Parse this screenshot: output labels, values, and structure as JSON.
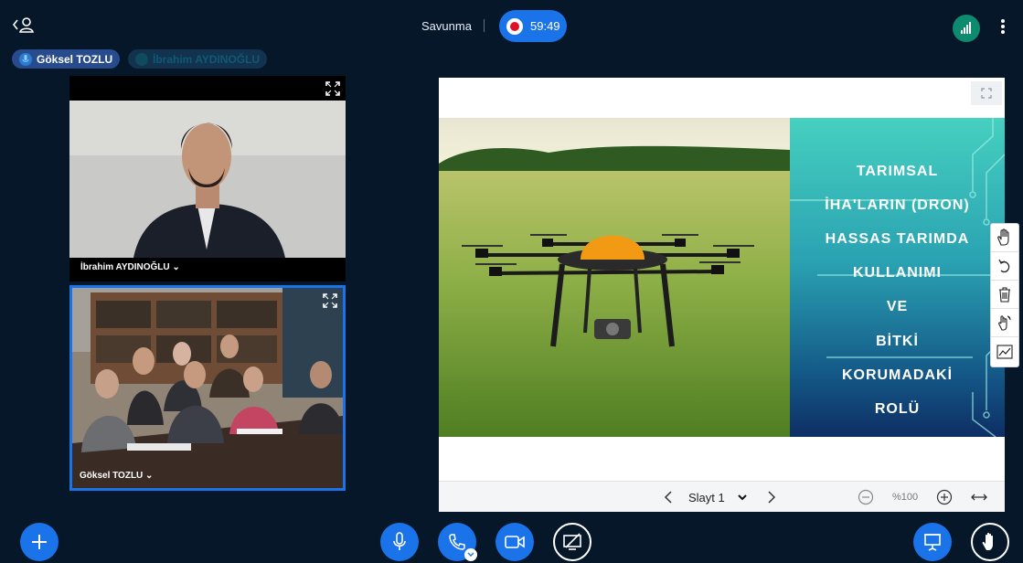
{
  "header": {
    "title": "Savunma",
    "timer": "59:49",
    "icons": [
      "user-icon",
      "record-icon",
      "connection-icon",
      "more-vertical-icon"
    ]
  },
  "participants": {
    "tags": [
      {
        "name": "Göksel TOZLU",
        "talking": true
      },
      {
        "name": "İbrahim AYDINOĞLU",
        "talking": false
      }
    ]
  },
  "videos": [
    {
      "label": "İbrahim AYDINOĞLU ⌄"
    },
    {
      "label": "Göksel TOZLU ⌄"
    }
  ],
  "slide": {
    "lines": [
      "TARIMSAL",
      "İHA'LARIN (DRON)",
      "HASSAS TARIMDA",
      "KULLANIMI",
      "VE",
      "BİTKİ",
      "KORUMADAKİ",
      "ROLÜ"
    ],
    "colors": {
      "panel_top": "#46d0c0",
      "panel_bottom": "#0e2e64",
      "field": "#7fa43a",
      "drone_dome": "#f39a14"
    }
  },
  "presentation_footer": {
    "slide_label": "Slayt 1",
    "zoom": "%100"
  },
  "annotation_tools": [
    "pan-hand-icon",
    "undo-icon",
    "trash-icon",
    "multi-user-pointer-icon",
    "chart-icon"
  ],
  "controls": {
    "accent": "#1a73e8",
    "buttons": [
      "plus-icon",
      "microphone-icon",
      "phone-icon",
      "camera-icon",
      "screen-share-off-icon",
      "presentation-icon",
      "raise-hand-icon"
    ]
  }
}
